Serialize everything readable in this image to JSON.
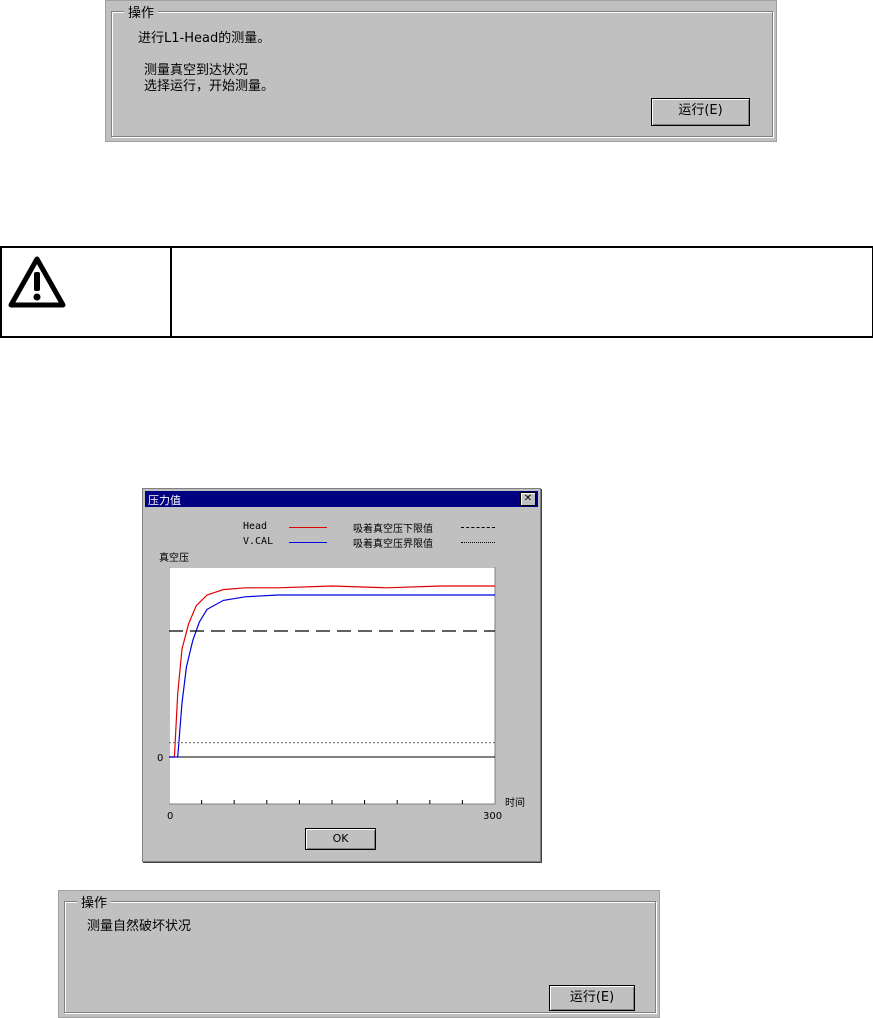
{
  "top_panel": {
    "group_title": "操作",
    "line1": "进行L1-Head的测量。",
    "line2": "测量真空到达状况",
    "line3": "选择运行，开始测量。",
    "run_button": "运行(E)"
  },
  "warning_box": {
    "icon": "warning-triangle-icon",
    "text": ""
  },
  "pressure_dialog": {
    "title": "压力值",
    "close_label": "✕",
    "legend": {
      "head": "Head",
      "vcal": "V.CAL",
      "lower_limit": "吸着真空压下限值",
      "boundary_limit": "吸着真空压界限值"
    },
    "ylabel": "真空压",
    "xlabel": "时间",
    "y_zero_label": "0",
    "x_start_label": "0",
    "x_end_label": "300",
    "ok_button": "OK",
    "colors": {
      "head": "#e00000",
      "vcal": "#0000e0"
    }
  },
  "bottom_panel": {
    "group_title": "操作",
    "line1": "测量自然破坏状况",
    "run_button": "运行(E)"
  },
  "chart_data": {
    "type": "line",
    "xlabel": "时间",
    "ylabel": "真空压",
    "xlim": [
      0,
      300
    ],
    "xticks": [
      0,
      300
    ],
    "yticks": [
      0
    ],
    "series": [
      {
        "name": "Head",
        "x": [
          0,
          5,
          8,
          12,
          18,
          25,
          35,
          50,
          70,
          100,
          150,
          200,
          250,
          300
        ],
        "values": [
          0,
          0,
          0.35,
          0.6,
          0.74,
          0.84,
          0.9,
          0.93,
          0.94,
          0.94,
          0.95,
          0.94,
          0.95,
          0.95
        ]
      },
      {
        "name": "V.CAL",
        "x": [
          0,
          8,
          12,
          16,
          22,
          28,
          35,
          50,
          70,
          100,
          150,
          200,
          250,
          300
        ],
        "values": [
          0,
          0,
          0.3,
          0.5,
          0.65,
          0.75,
          0.82,
          0.87,
          0.89,
          0.9,
          0.9,
          0.9,
          0.9,
          0.9
        ]
      },
      {
        "name": "吸着真空压下限值",
        "x": [
          0,
          300
        ],
        "values": [
          0.7,
          0.7
        ]
      },
      {
        "name": "吸着真空压界限值",
        "x": [
          0,
          300
        ],
        "values": [
          0.08,
          0.08
        ]
      }
    ]
  }
}
